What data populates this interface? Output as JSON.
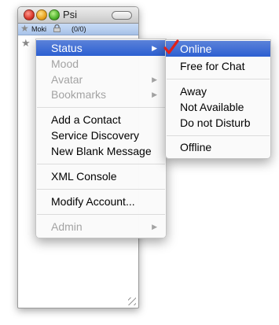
{
  "window": {
    "title": "Psi"
  },
  "account": {
    "name": "Moki",
    "count": "(0/0)"
  },
  "menu": {
    "items": [
      {
        "label": "Status",
        "enabled": true,
        "submenu": true,
        "highlighted": true
      },
      {
        "label": "Mood",
        "enabled": false
      },
      {
        "label": "Avatar",
        "enabled": false,
        "submenu": true
      },
      {
        "label": "Bookmarks",
        "enabled": false,
        "submenu": true
      },
      {
        "label": "Add a Contact",
        "enabled": true
      },
      {
        "label": "Service Discovery",
        "enabled": true
      },
      {
        "label": "New Blank Message",
        "enabled": true
      },
      {
        "label": "XML Console",
        "enabled": true
      },
      {
        "label": "Modify Account...",
        "enabled": true
      },
      {
        "label": "Admin",
        "enabled": false,
        "submenu": true
      }
    ],
    "arrow_glyph": "▶"
  },
  "status_menu": {
    "items": [
      {
        "label": "Online",
        "checked": true,
        "highlighted": true
      },
      {
        "label": "Free for Chat"
      },
      {
        "label": "Away"
      },
      {
        "label": "Not Available"
      },
      {
        "label": "Do not Disturb"
      },
      {
        "label": "Offline"
      }
    ]
  },
  "colors": {
    "highlight": "#2c5fd1",
    "check": "#e0201a",
    "disabled_text": "#a3a3a3"
  }
}
